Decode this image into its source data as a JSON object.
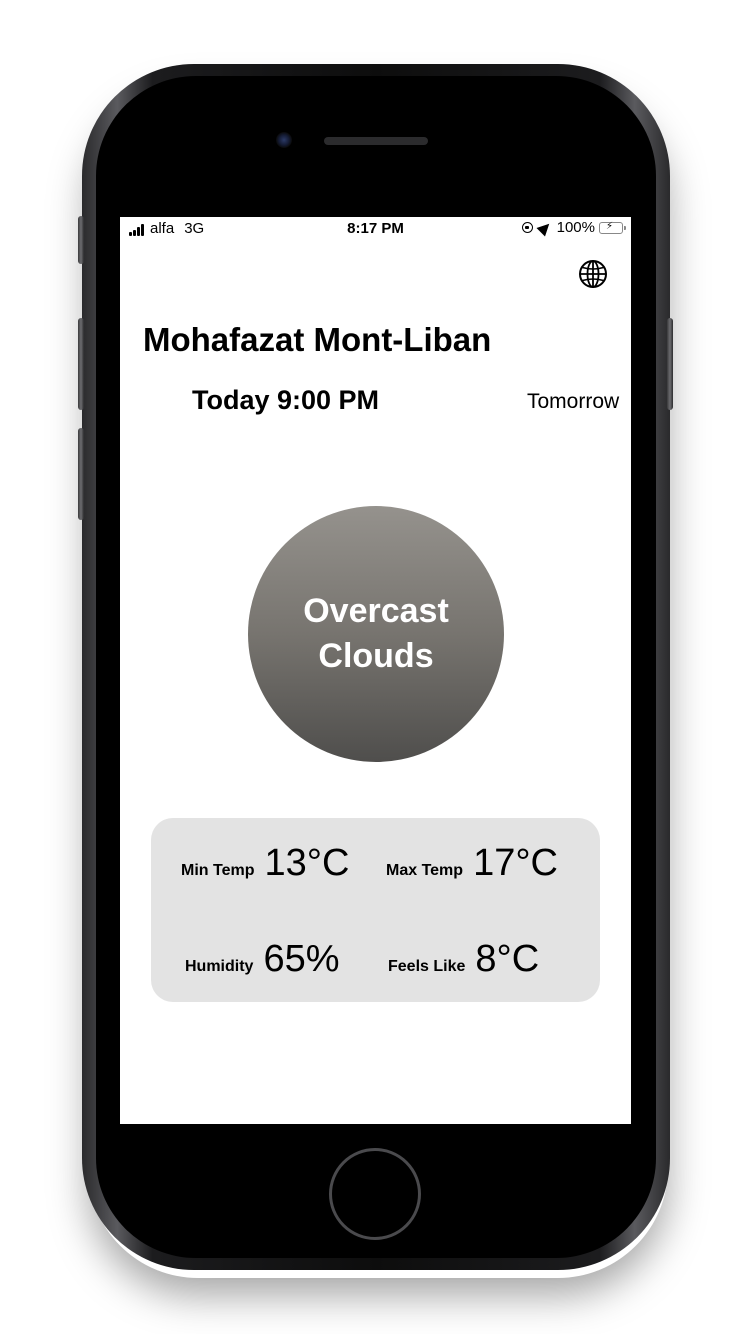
{
  "status_bar": {
    "carrier": "alfa",
    "network": "3G",
    "time": "8:17 PM",
    "battery": "100%",
    "battery_color": "#4cd964"
  },
  "header": {
    "location": "Mohafazat Mont-Liban",
    "globe_icon": "globe-icon"
  },
  "tabs": {
    "today": "Today 9:00 PM",
    "tomorrow": "Tomorrow"
  },
  "condition": {
    "label": "Overcast Clouds"
  },
  "stats": {
    "min_temp_label": "Min Temp",
    "min_temp_value": "13°C",
    "max_temp_label": "Max Temp",
    "max_temp_value": "17°C",
    "humidity_label": "Humidity",
    "humidity_value": "65%",
    "feels_like_label": "Feels Like",
    "feels_like_value": "8°C"
  }
}
